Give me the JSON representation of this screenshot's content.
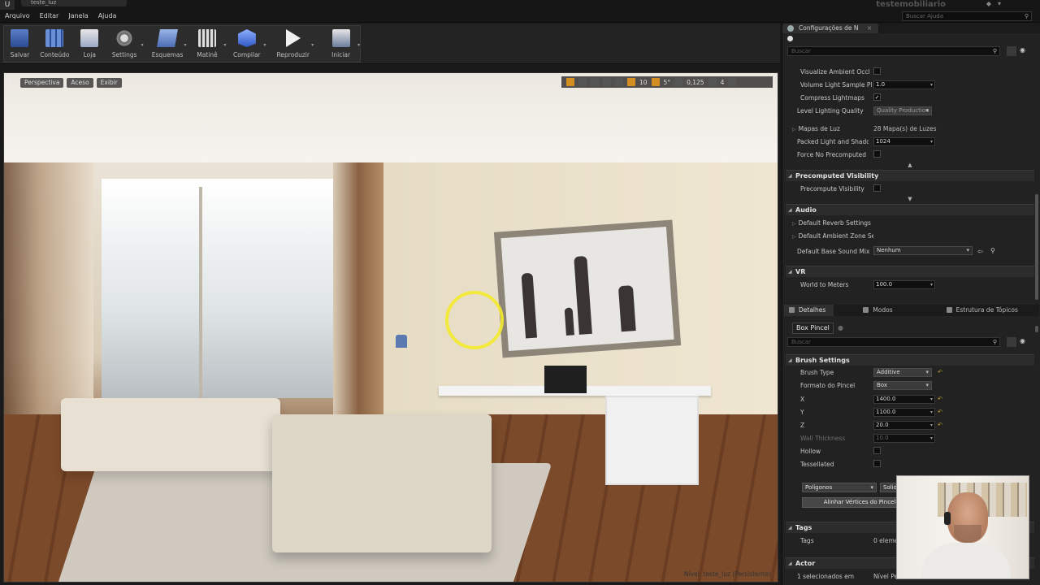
{
  "titlebar": {
    "logo": "U",
    "doc_tab": "teste_luz",
    "project_name": "testemobiliario",
    "menu": [
      "Arquivo",
      "Editar",
      "Janela",
      "Ajuda"
    ],
    "help_search_placeholder": "Buscar Ajuda"
  },
  "toolbar": {
    "buttons": [
      {
        "label": "Salvar",
        "icon": "save-icon"
      },
      {
        "label": "Conteúdo",
        "icon": "content-browser-icon"
      },
      {
        "label": "Loja",
        "icon": "marketplace-icon"
      },
      {
        "label": "Settings",
        "icon": "settings-icon"
      },
      {
        "label": "Esquemas",
        "icon": "blueprint-icon"
      },
      {
        "label": "Matinê",
        "icon": "matinee-icon"
      },
      {
        "label": "Compilar",
        "icon": "build-icon"
      },
      {
        "label": "Reproduzir",
        "icon": "play-icon"
      },
      {
        "label": "Iniciar",
        "icon": "launch-icon"
      }
    ]
  },
  "viewport": {
    "btn_perspective": "Perspectiva",
    "btn_lit": "Aceso",
    "btn_show": "Exibir",
    "grid_snap": "10",
    "rotation_snap": "5°",
    "scale_snap": "0,125",
    "camera_speed": "4",
    "status_label": "Nível:",
    "status_level": "teste_luz (Persistente)"
  },
  "world_settings": {
    "tab_label": "Configurações de N",
    "search_placeholder": "Buscar",
    "rows_top": [
      {
        "label": "Visualize Ambient Occl",
        "type": "check",
        "checked": false
      },
      {
        "label": "Volume Light Sample Pl",
        "type": "num",
        "value": "1.0"
      },
      {
        "label": "Compress Lightmaps",
        "type": "check",
        "checked": true
      },
      {
        "label": "Level Lighting Quality",
        "type": "combo",
        "value": "Quality Production"
      }
    ],
    "rows_lightmass": [
      {
        "label": "Mapas de Luz",
        "type": "text",
        "value": "28 Mapa(s) de Luzes"
      },
      {
        "label": "Packed Light and Shadow",
        "type": "num",
        "value": "1024"
      },
      {
        "label": "Force No Precomputed Li",
        "type": "check",
        "checked": false
      }
    ],
    "cat_precomputed": "Precomputed Visibility",
    "precompute_visibility_label": "Precompute Visibility",
    "cat_audio": "Audio",
    "audio_reverb": "Default Reverb Settings",
    "audio_ambient": "Default Ambient Zone Set",
    "audio_basemix": "Default Base Sound Mix",
    "audio_basemix_value": "Nenhum",
    "cat_vr": "VR",
    "vr_world_to_meters": "World to Meters",
    "vr_world_to_meters_value": "100.0"
  },
  "details": {
    "tabs": [
      "Detalhes",
      "Modos",
      "Estrutura de Tópicos"
    ],
    "actor_name": "Box Pincel",
    "search_placeholder": "Buscar",
    "cat_brush": "Brush Settings",
    "brush_type_label": "Brush Type",
    "brush_type_value": "Additive",
    "brush_shape_label": "Formato do Pincel",
    "brush_shape_value": "Box",
    "x_label": "X",
    "x_value": "1400.0",
    "y_label": "Y",
    "y_value": "1100.0",
    "z_label": "Z",
    "z_value": "20.0",
    "wall_label": "Wall Thickness",
    "wall_value": "10.0",
    "hollow_label": "Hollow",
    "tessellated_label": "Tessellated",
    "polygons_combo": "Polígonos",
    "solidity_combo": "Solide",
    "align_button": "Alinhar Vértices do Pincel",
    "cat_tags": "Tags",
    "tags_label": "Tags",
    "tags_value": "0 eleme",
    "cat_actor": "Actor",
    "selected_label": "1 selecionados em",
    "selected_value": "Nível Pe"
  }
}
